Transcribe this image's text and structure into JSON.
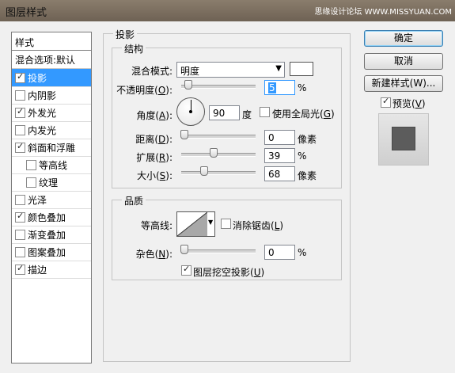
{
  "window": {
    "title": "图层样式",
    "watermark": "思缘设计论坛 WWW.MISSYUAN.COM"
  },
  "style_list": {
    "header": "样式",
    "blend_options": "混合选项:默认",
    "items": [
      {
        "label": "投影",
        "checked": true,
        "selected": true,
        "indent": false
      },
      {
        "label": "内阴影",
        "checked": false,
        "selected": false,
        "indent": false
      },
      {
        "label": "外发光",
        "checked": true,
        "selected": false,
        "indent": false
      },
      {
        "label": "内发光",
        "checked": false,
        "selected": false,
        "indent": false
      },
      {
        "label": "斜面和浮雕",
        "checked": true,
        "selected": false,
        "indent": false
      },
      {
        "label": "等高线",
        "checked": false,
        "selected": false,
        "indent": true
      },
      {
        "label": "纹理",
        "checked": false,
        "selected": false,
        "indent": true
      },
      {
        "label": "光泽",
        "checked": false,
        "selected": false,
        "indent": false
      },
      {
        "label": "颜色叠加",
        "checked": true,
        "selected": false,
        "indent": false
      },
      {
        "label": "渐变叠加",
        "checked": false,
        "selected": false,
        "indent": false
      },
      {
        "label": "图案叠加",
        "checked": false,
        "selected": false,
        "indent": false
      },
      {
        "label": "描边",
        "checked": true,
        "selected": false,
        "indent": false
      }
    ]
  },
  "panel": {
    "title": "投影",
    "structure": {
      "title": "结构",
      "blend_mode_label": "混合模式:",
      "blend_mode_value": "明度",
      "blend_color": "#ffffff",
      "opacity_label": "不透明度",
      "opacity_key": "O",
      "opacity_value": "5",
      "opacity_unit": "%",
      "opacity_level": 0.05,
      "angle_label": "角度",
      "angle_key": "A",
      "angle_value": "90",
      "angle_unit": "度",
      "global_light_label": "使用全局光",
      "global_light_key": "G",
      "global_light_checked": false,
      "distance_label": "距离",
      "distance_key": "D",
      "distance_value": "0",
      "distance_unit": "像素",
      "distance_level": 0.0,
      "spread_label": "扩展",
      "spread_key": "R",
      "spread_value": "39",
      "spread_unit": "%",
      "spread_level": 0.39,
      "size_label": "大小",
      "size_key": "S",
      "size_value": "68",
      "size_unit": "像素",
      "size_level": 0.27
    },
    "quality": {
      "title": "品质",
      "contour_label": "等高线:",
      "antialias_label": "消除锯齿",
      "antialias_key": "L",
      "antialias_checked": false,
      "noise_label": "杂色",
      "noise_key": "N",
      "noise_value": "0",
      "noise_unit": "%",
      "noise_level": 0.0
    },
    "knockout_label": "图层挖空投影",
    "knockout_key": "U",
    "knockout_checked": true
  },
  "buttons": {
    "ok": "确定",
    "cancel": "取消",
    "new_style": "新建样式(W)...",
    "preview_label": "预览",
    "preview_key": "V",
    "preview_checked": true
  }
}
